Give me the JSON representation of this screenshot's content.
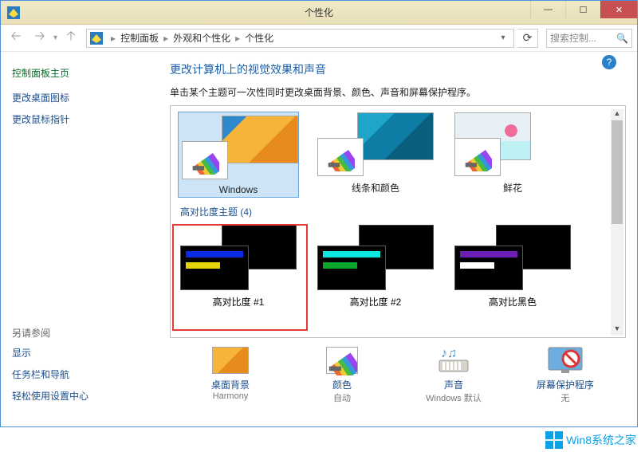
{
  "window": {
    "title": "个性化"
  },
  "nav": {
    "crumbs": [
      "控制面板",
      "外观和个性化",
      "个性化"
    ],
    "search_placeholder": "搜索控制..."
  },
  "sidebar": {
    "home": "控制面板主页",
    "links": [
      "更改桌面图标",
      "更改鼠标指针"
    ],
    "see_also_label": "另请参阅",
    "see_also": [
      "显示",
      "任务栏和导航",
      "轻松使用设置中心"
    ]
  },
  "content": {
    "heading": "更改计算机上的视觉效果和声音",
    "subtext": "单击某个主题可一次性同时更改桌面背景、颜色、声音和屏幕保护程序。",
    "themes_row1": [
      {
        "label": "Windows",
        "selected": true,
        "bgstyle": "win"
      },
      {
        "label": "线条和颜色",
        "bgstyle": "lines"
      },
      {
        "label": "鲜花",
        "bgstyle": "flowers"
      }
    ],
    "hc_label": "高对比度主题 (4)",
    "hc_row": [
      {
        "label": "高对比度 #1",
        "colors": [
          "#0a2ae5",
          "#e6d40a"
        ]
      },
      {
        "label": "高对比度 #2",
        "colors": [
          "#0ee6e0",
          "#0aa52a"
        ]
      },
      {
        "label": "高对比黑色",
        "colors": [
          "#6a1eb5",
          "#ffffff"
        ]
      }
    ],
    "bottom": [
      {
        "label": "桌面背景",
        "sub": "Harmony",
        "icon": "wallpaper"
      },
      {
        "label": "颜色",
        "sub": "自动",
        "icon": "color"
      },
      {
        "label": "声音",
        "sub": "Windows 默认",
        "icon": "sound"
      },
      {
        "label": "屏幕保护程序",
        "sub": "无",
        "icon": "screensaver"
      }
    ]
  },
  "watermark": "Win8系统之家"
}
